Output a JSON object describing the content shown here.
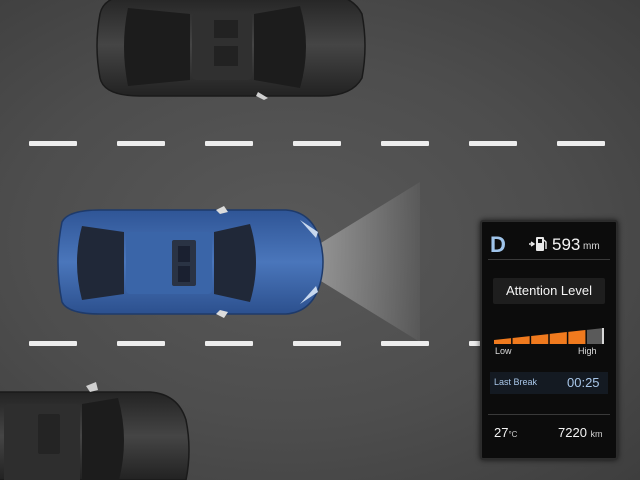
{
  "hud": {
    "gear": "D",
    "fuel_range_value": "593",
    "fuel_range_unit": "mm",
    "attention_label": "Attention Level",
    "attention_level_fraction": 0.78,
    "attention_segments": 6,
    "scale_low_label": "Low",
    "scale_high_label": "High",
    "last_break_label": "Last Break",
    "last_break_time": "00:25",
    "temperature_value": "27",
    "temperature_unit": "°C",
    "odometer_value": "7220",
    "odometer_unit": "km"
  },
  "colors": {
    "road": "#4d4d4d",
    "lane_marking": "#ededed",
    "ego_car": "#3c64a6",
    "other_cars": "#3a3a3a",
    "gear_accent": "#9fc4ea",
    "attention_fill": "#f07a1e",
    "attention_empty": "#5a5a5a"
  },
  "icons": {
    "fuel": "fuel-pump-icon"
  }
}
